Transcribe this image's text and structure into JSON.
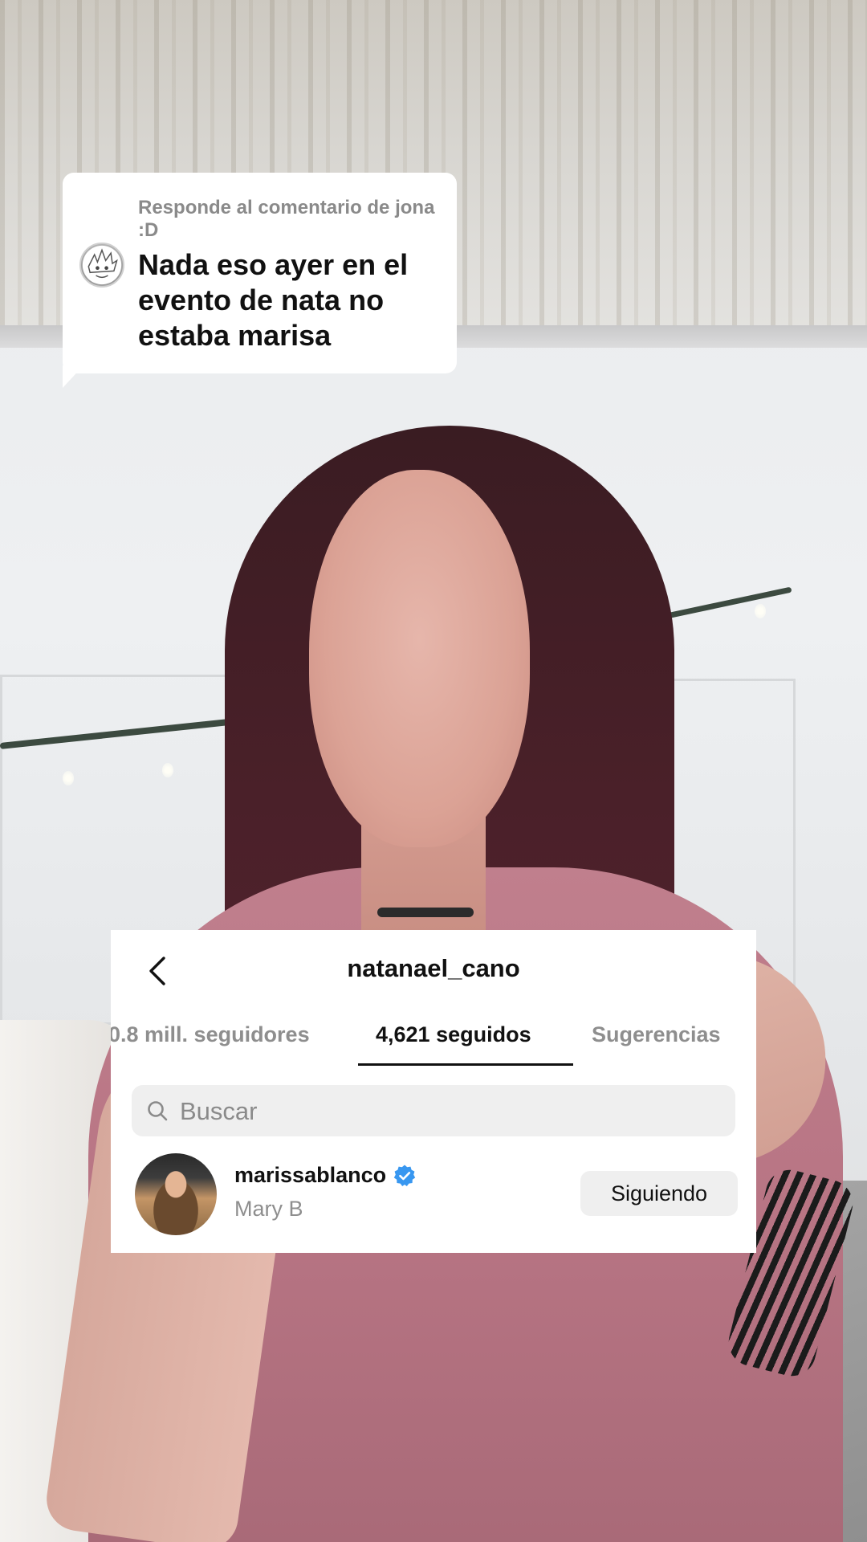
{
  "comment_reply": {
    "header": "Responde al comentario de jona :D",
    "text": "Nada eso ayer en el evento de nata no estaba marisa"
  },
  "profile": {
    "username": "natanael_cano"
  },
  "tabs": [
    {
      "label": "0.8 mill. seguidores",
      "active": false
    },
    {
      "label": "4,621 seguidos",
      "active": true
    },
    {
      "label": "Sugerencias",
      "active": false
    }
  ],
  "search": {
    "placeholder": "Buscar",
    "icon": "search-icon"
  },
  "following_list": [
    {
      "username": "marissablanco",
      "verified": true,
      "display_name": "Mary B",
      "button_label": "Siguiendo"
    }
  ],
  "colors": {
    "verified_badge": "#3897f0",
    "active_tab": "#111111",
    "inactive_tab": "#8e8e8e",
    "button_bg": "#efefef"
  },
  "icons": [
    "back-arrow-icon",
    "search-icon",
    "verified-badge-icon"
  ]
}
